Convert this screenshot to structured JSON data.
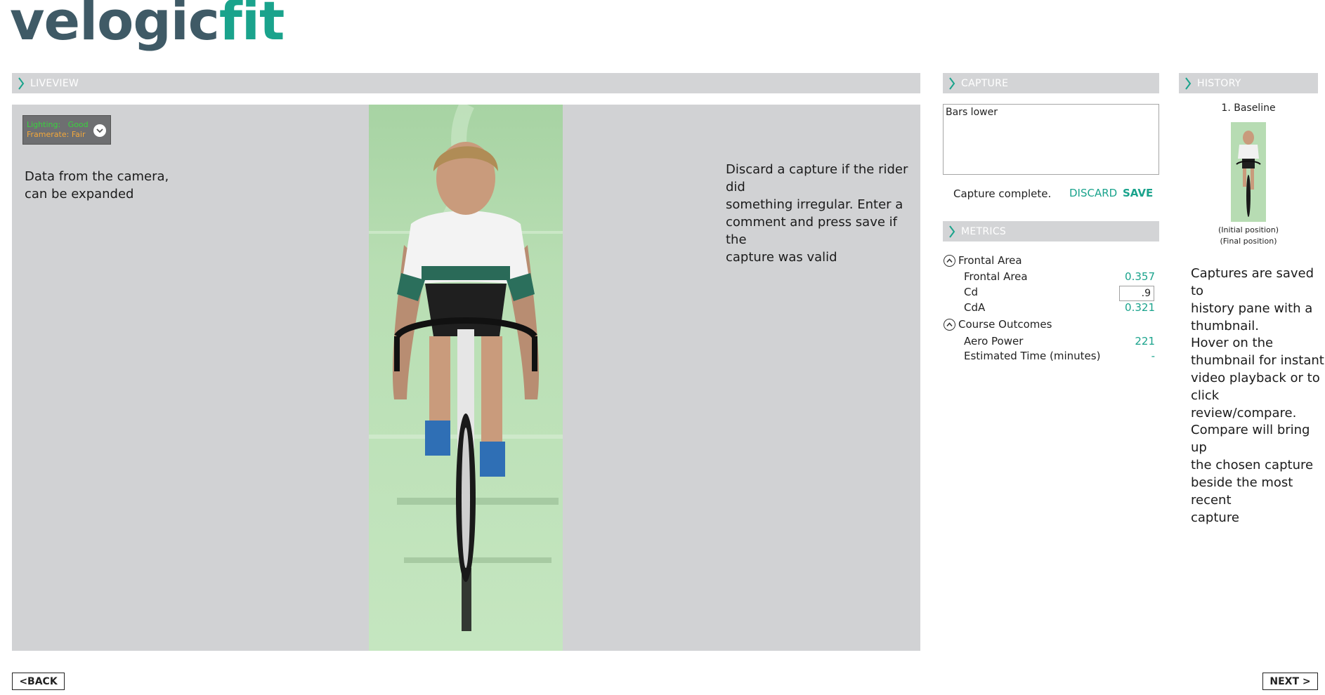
{
  "logo": {
    "part1": "velogic",
    "part2": "fit"
  },
  "liveview": {
    "header": "LIVEVIEW",
    "camera_status": {
      "lighting_label": "Lighting:",
      "lighting_value": "Good",
      "framerate_label": "Framerate:",
      "framerate_value": "Fair"
    },
    "note_left": [
      "Data from the camera,",
      "can be expanded"
    ],
    "note_right": [
      "Discard a capture if the rider did",
      "something irregular. Enter a",
      "comment and press save if the",
      "capture was valid"
    ]
  },
  "capture": {
    "header": "CAPTURE",
    "comment": "Bars lower",
    "status": "Capture complete.",
    "discard_label": "DISCARD",
    "save_label": "SAVE"
  },
  "metrics": {
    "header": "METRICS",
    "groups": [
      {
        "title": "Frontal Area",
        "rows": [
          {
            "label": "Frontal Area",
            "value": "0.357"
          },
          {
            "label": "Cd",
            "value": ".9"
          },
          {
            "label": "CdA",
            "value": "0.321"
          }
        ]
      },
      {
        "title": "Course Outcomes",
        "rows": [
          {
            "label": "Aero Power",
            "value": "221"
          },
          {
            "label": "Estimated Time (minutes)",
            "value": "-"
          }
        ]
      }
    ]
  },
  "history": {
    "header": "HISTORY",
    "items": [
      {
        "title": "1. Baseline",
        "caption1": "(Initial position)",
        "caption2": "(Final position)"
      }
    ],
    "notes": [
      [
        "Captures are saved to",
        "history pane with a",
        "thumbnail."
      ],
      [
        "Hover on the",
        "thumbnail for instant",
        "video playback or to",
        "click review/compare."
      ],
      [
        "Compare will bring up",
        "the chosen capture",
        "beside the most recent",
        "capture"
      ]
    ]
  },
  "nav": {
    "back_label": "<BACK",
    "next_label": "NEXT >"
  },
  "colors": {
    "accent": "#1aa38c",
    "logo_dark": "#3f5a66",
    "panel_bg": "#d1d2d4",
    "header_bg": "#d3d4d6",
    "good": "#39d33e",
    "fair": "#f4a83a"
  },
  "icons": {
    "header": "chevron-right-icon",
    "expand": "chevron-down-circle-icon",
    "collapse": "chevron-up-circle-icon"
  }
}
